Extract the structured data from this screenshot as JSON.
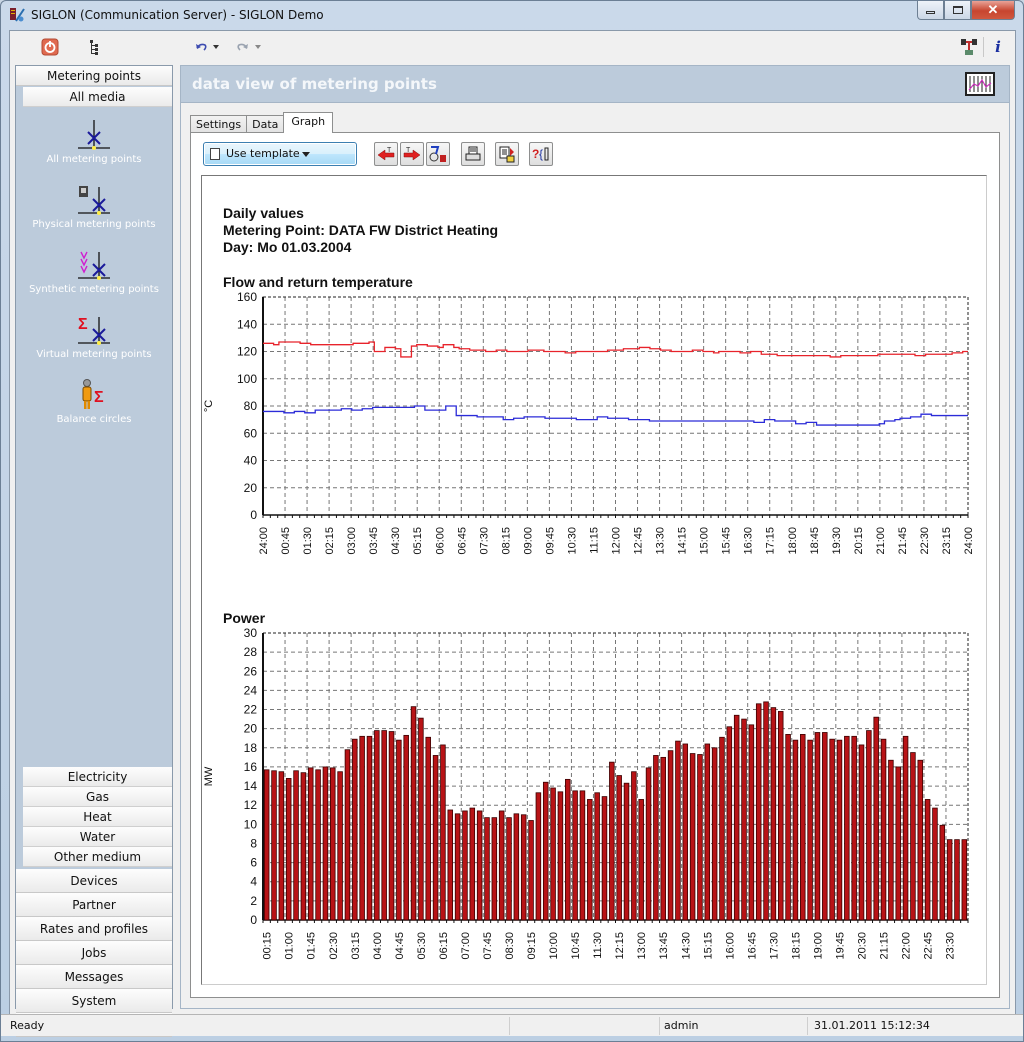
{
  "window": {
    "title": "SIGLON (Communication Server) - SIGLON Demo",
    "controls": {
      "minimize": "minimize",
      "maximize": "maximize",
      "close": "close"
    }
  },
  "toolbar": {
    "icons": [
      "power-icon",
      "tree-view-icon",
      "undo-icon",
      "redo-icon",
      "network-icon",
      "info-icon"
    ]
  },
  "sidebar": {
    "header": "Metering points",
    "sub_header": "All media",
    "items": [
      {
        "label": "All metering points",
        "icon": "metering-point-icon"
      },
      {
        "label": "Physical metering points",
        "icon": "physical-metering-point-icon"
      },
      {
        "label": "Synthetic metering points",
        "icon": "synthetic-metering-point-icon"
      },
      {
        "label": "Virtual metering points",
        "icon": "virtual-metering-point-icon"
      },
      {
        "label": "Balance circles",
        "icon": "balance-circle-icon"
      }
    ],
    "media": [
      "Electricity",
      "Gas",
      "Heat",
      "Water",
      "Other medium"
    ],
    "sections": [
      "Devices",
      "Partner",
      "Rates and profiles",
      "Jobs",
      "Messages",
      "System",
      "admin"
    ]
  },
  "main": {
    "title": "data view of metering points",
    "tabs": [
      {
        "label": "Settings",
        "active": false
      },
      {
        "label": "Data",
        "active": false
      },
      {
        "label": "Graph",
        "active": true
      }
    ],
    "template_button": "Use template",
    "tool_buttons": [
      "previous-day",
      "next-day",
      "chart-settings",
      "print",
      "export",
      "help"
    ]
  },
  "report": {
    "line1": "Daily values",
    "line2": "Metering Point: DATA FW District Heating",
    "line3": "Day: Mo 01.03.2004"
  },
  "chart_data": [
    {
      "type": "line",
      "title": "Flow and return temperature",
      "xlabel": "",
      "ylabel": "°C",
      "ylim": [
        0,
        160
      ],
      "yticks": [
        0,
        20,
        40,
        60,
        80,
        100,
        120,
        140,
        160
      ],
      "grid": true,
      "x_tick_labels": [
        "24:00",
        "00:45",
        "01:30",
        "02:15",
        "03:00",
        "03:45",
        "04:30",
        "05:15",
        "06:00",
        "06:45",
        "07:30",
        "08:15",
        "09:00",
        "09:45",
        "10:30",
        "11:15",
        "12:00",
        "12:45",
        "13:30",
        "14:15",
        "15:00",
        "15:45",
        "16:30",
        "17:15",
        "18:00",
        "18:45",
        "19:30",
        "20:15",
        "21:00",
        "21:45",
        "22:30",
        "23:15",
        "24:00"
      ],
      "series": [
        {
          "name": "Flow temperature",
          "color": "#e8232b",
          "values": [
            126,
            126,
            125,
            127,
            127,
            127,
            127,
            126,
            126,
            125,
            125,
            125,
            125,
            125,
            125,
            125,
            125,
            126,
            126,
            126,
            127,
            120,
            120,
            123,
            123,
            122,
            116,
            116,
            124,
            125,
            125,
            124,
            124,
            123,
            125,
            125,
            123,
            122,
            122,
            121,
            121,
            121,
            120,
            120,
            121,
            121,
            120,
            120,
            120,
            120,
            121,
            121,
            121,
            120,
            120,
            120,
            120,
            119,
            119,
            120,
            120,
            120,
            120,
            120,
            120,
            121,
            121,
            121,
            122,
            122,
            122,
            123,
            123,
            122,
            122,
            121,
            121,
            120,
            120,
            120,
            120,
            121,
            121,
            120,
            120,
            119,
            120,
            120,
            120,
            120,
            119,
            119,
            120,
            120,
            118,
            118,
            118,
            117,
            117,
            117,
            117,
            117,
            117,
            117,
            117,
            117,
            117,
            116,
            116,
            117,
            117,
            117,
            117,
            117,
            117,
            117,
            118,
            118,
            118,
            118,
            118,
            118,
            118,
            117,
            117,
            118,
            118,
            118,
            118,
            118,
            119,
            119,
            120
          ]
        },
        {
          "name": "Return temperature",
          "color": "#2b2bd8",
          "values": [
            76,
            76,
            76,
            76,
            75,
            75,
            76,
            76,
            75,
            75,
            77,
            77,
            77,
            77,
            77,
            78,
            78,
            77,
            77,
            78,
            78,
            79,
            79,
            79,
            79,
            79,
            79,
            79,
            79,
            80,
            80,
            77,
            77,
            77,
            77,
            80,
            80,
            73,
            73,
            73,
            73,
            72,
            72,
            72,
            72,
            72,
            70,
            70,
            71,
            71,
            72,
            72,
            72,
            72,
            71,
            71,
            71,
            71,
            71,
            71,
            70,
            70,
            70,
            70,
            72,
            72,
            71,
            71,
            71,
            71,
            70,
            70,
            70,
            70,
            69,
            69,
            69,
            69,
            69,
            69,
            69,
            69,
            69,
            69,
            69,
            69,
            69,
            69,
            69,
            69,
            69,
            69,
            69,
            69,
            68,
            68,
            70,
            70,
            69,
            69,
            69,
            69,
            67,
            67,
            68,
            68,
            66,
            66,
            66,
            66,
            66,
            66,
            66,
            66,
            66,
            66,
            66,
            66,
            67,
            69,
            69,
            70,
            71,
            71,
            72,
            72,
            74,
            74,
            73,
            73,
            73,
            73,
            73,
            73,
            73
          ]
        }
      ]
    },
    {
      "type": "bar",
      "title": "Power",
      "xlabel": "",
      "ylabel": "MW",
      "ylim": [
        0,
        30
      ],
      "yticks": [
        0,
        2,
        4,
        6,
        8,
        10,
        12,
        14,
        16,
        18,
        20,
        22,
        24,
        26,
        28,
        30
      ],
      "grid": true,
      "color": "#b81316",
      "x_tick_labels": [
        "00:15",
        "01:00",
        "01:45",
        "02:30",
        "03:15",
        "04:00",
        "04:45",
        "05:30",
        "06:15",
        "07:00",
        "07:45",
        "08:30",
        "09:15",
        "10:00",
        "10:45",
        "11:30",
        "12:15",
        "13:00",
        "13:45",
        "14:30",
        "15:15",
        "16:00",
        "16:45",
        "17:30",
        "18:15",
        "19:00",
        "19:45",
        "20:30",
        "21:15",
        "22:00",
        "22:45",
        "23:30"
      ],
      "values": [
        15.7,
        15.6,
        15.5,
        14.8,
        15.6,
        15.4,
        15.9,
        15.7,
        16.0,
        15.9,
        15.5,
        17.8,
        18.9,
        19.2,
        19.2,
        19.8,
        19.8,
        19.7,
        18.8,
        19.3,
        22.3,
        21.1,
        19.1,
        17.2,
        18.3,
        11.5,
        11.1,
        11.4,
        11.7,
        11.4,
        10.7,
        10.7,
        11.4,
        10.7,
        11.1,
        11.0,
        10.4,
        13.3,
        14.4,
        13.8,
        13.4,
        14.7,
        13.5,
        13.5,
        12.6,
        13.3,
        12.9,
        16.5,
        15.1,
        14.3,
        15.5,
        12.6,
        15.9,
        17.2,
        17.0,
        17.7,
        18.7,
        18.4,
        17.4,
        17.3,
        18.4,
        18.0,
        19.1,
        20.2,
        21.4,
        21.0,
        20.4,
        22.6,
        22.8,
        22.2,
        21.8,
        19.4,
        18.8,
        19.4,
        18.8,
        19.6,
        19.6,
        18.9,
        18.8,
        19.2,
        19.2,
        18.3,
        19.8,
        21.2,
        18.9,
        16.7,
        16.0,
        19.2,
        17.5,
        16.7,
        12.6,
        11.7,
        9.9,
        8.4,
        8.4,
        8.4
      ]
    }
  ],
  "status": {
    "text": "Ready",
    "user": "admin",
    "datetime": "31.01.2011 15:12:34"
  }
}
